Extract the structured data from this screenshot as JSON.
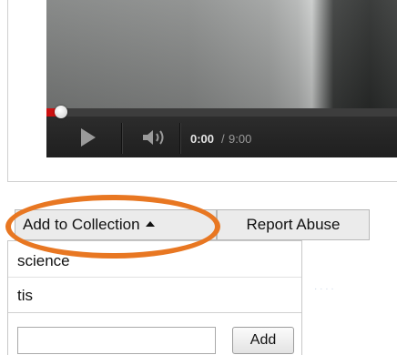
{
  "player": {
    "current_time": "0:00",
    "separator": "/",
    "total_time": "9:00",
    "progress_fraction": 0.0,
    "icons": [
      "play-icon",
      "volume-icon"
    ]
  },
  "actions": {
    "add_to_collection_label": "Add to Collection",
    "report_abuse_label": "Report Abuse"
  },
  "collection_menu": {
    "items": [
      "science",
      "tis"
    ],
    "new_collection_value": "",
    "add_label": "Add"
  },
  "colors": {
    "annotation_ring": "#e87722",
    "progress": "#cc1111"
  }
}
